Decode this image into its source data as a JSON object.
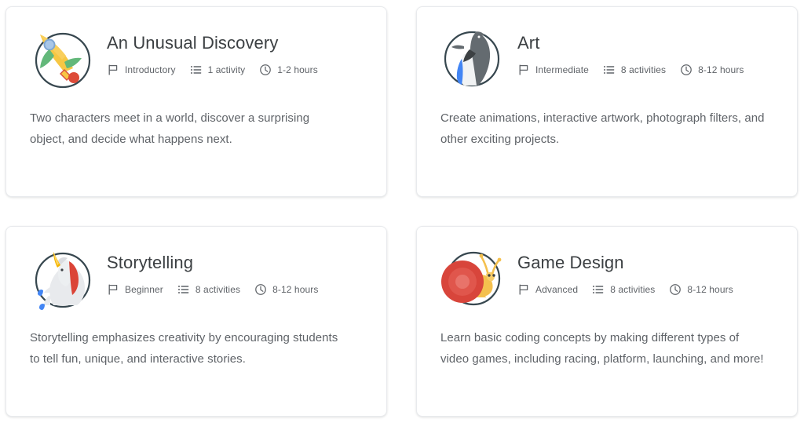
{
  "theme": {
    "page_background": "#ffffff",
    "card_background": "#ffffff",
    "card_border": "#e8eaed",
    "title_color": "#3c4043",
    "body_color": "#5f6368",
    "meta_color": "#5f6368",
    "accent_yellow": "#f4b400",
    "accent_red": "#db4437",
    "accent_blue": "#4285f4",
    "accent_green": "#0f9d58"
  },
  "meta_icons": {
    "level": "flag-icon",
    "activities": "list-icon",
    "duration": "clock-icon"
  },
  "cards": [
    {
      "id": "an-unusual-discovery",
      "title": "An Unusual Discovery",
      "thumbnail_icon": "rocket-icon",
      "level": "Introductory",
      "activities": "1 activity",
      "duration": "1-2 hours",
      "description": "Two characters meet in a world, discover a surprising object, and decide what happens next."
    },
    {
      "id": "art",
      "title": "Art",
      "thumbnail_icon": "penguin-icon",
      "level": "Intermediate",
      "activities": "8 activities",
      "duration": "8-12 hours",
      "description": "Create animations, interactive artwork, photograph filters, and other exciting projects."
    },
    {
      "id": "storytelling",
      "title": "Storytelling",
      "thumbnail_icon": "unicorn-icon",
      "level": "Beginner",
      "activities": "8 activities",
      "duration": "8-12 hours",
      "description": "Storytelling emphasizes creativity by encouraging students to tell fun, unique, and interactive stories."
    },
    {
      "id": "game-design",
      "title": "Game Design",
      "thumbnail_icon": "snail-icon",
      "level": "Advanced",
      "activities": "8 activities",
      "duration": "8-12 hours",
      "description": "Learn basic coding concepts by making different types of video games, including racing, platform, launching, and more!"
    }
  ]
}
